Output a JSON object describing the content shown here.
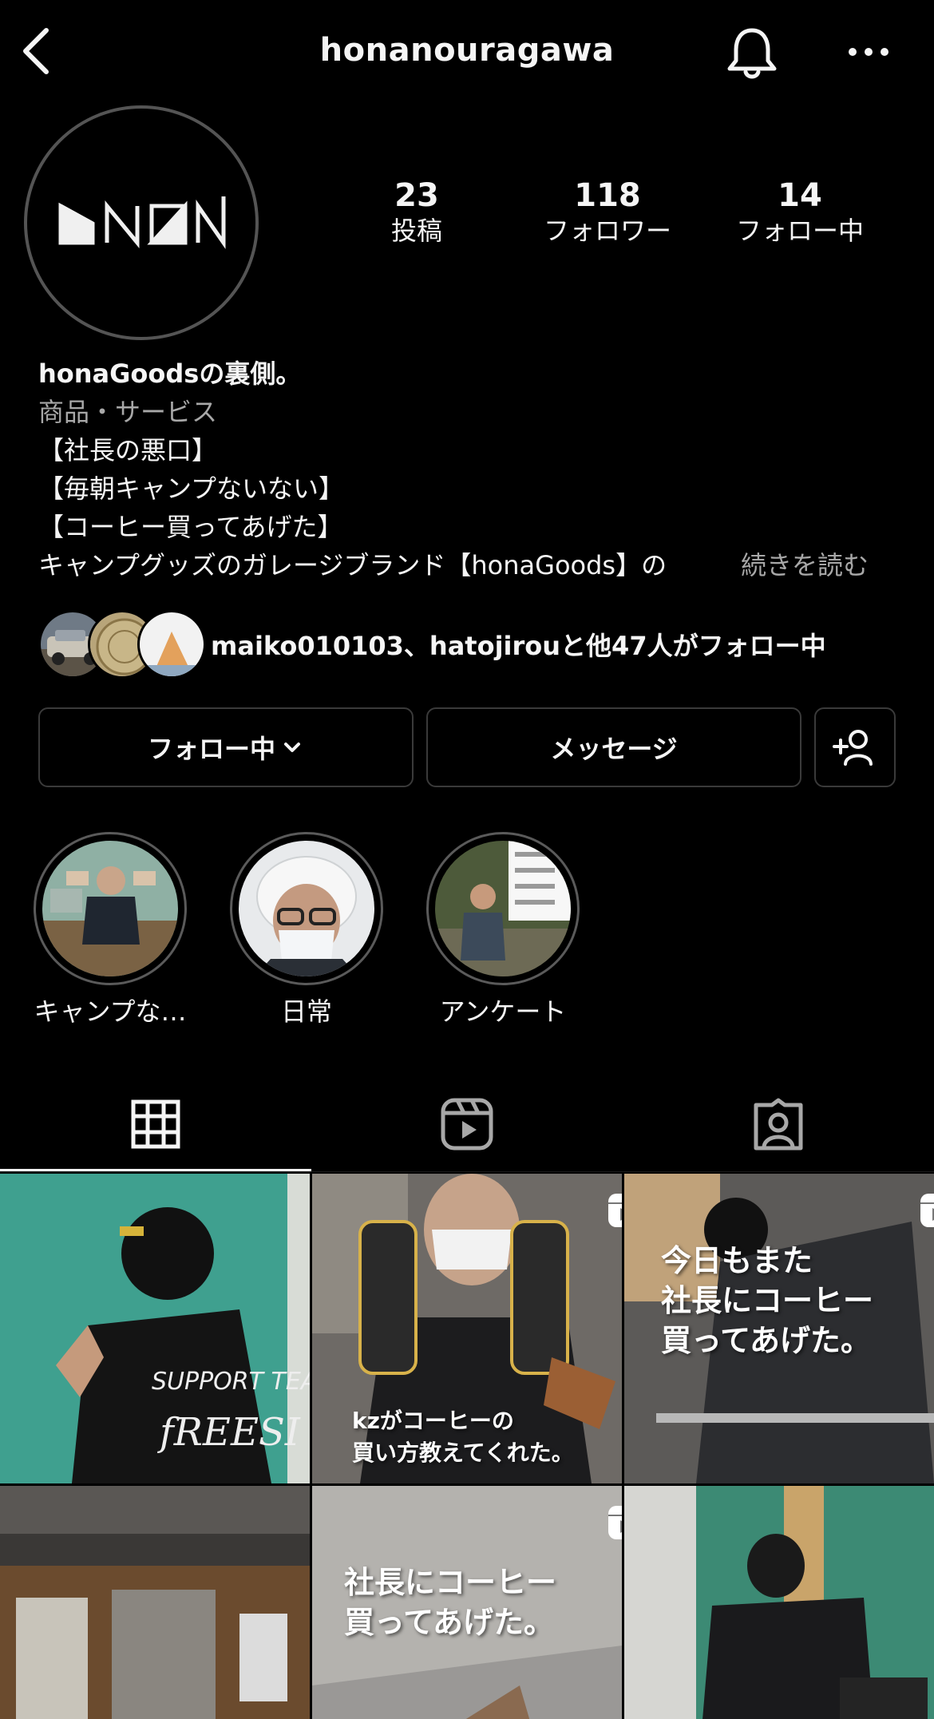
{
  "header": {
    "username": "honanouragawa"
  },
  "profile": {
    "logo_text": "ƅNON",
    "stats": [
      {
        "value": "23",
        "label": "投稿"
      },
      {
        "value": "118",
        "label": "フォロワー"
      },
      {
        "value": "14",
        "label": "フォロー中"
      }
    ]
  },
  "bio": {
    "name": "honaGoodsの裏側。",
    "category": "商品・サービス",
    "lines": [
      "【社長の悪口】",
      "【毎朝キャンプないない】",
      "【コーヒー買ってあげた】",
      "キャンプグッズのガレージブランド【honaGoods】の"
    ],
    "more": "続きを読む"
  },
  "followed_by": {
    "text": "maiko010103、hatojirouと他47人がフォロー中"
  },
  "actions": {
    "following_label": "フォロー中",
    "message_label": "メッセージ"
  },
  "highlights": [
    {
      "label": "キャンプな…"
    },
    {
      "label": "日常"
    },
    {
      "label": "アンケート"
    }
  ],
  "tabs": [
    {
      "name": "grid",
      "icon": "grid-icon",
      "active": true
    },
    {
      "name": "reels",
      "icon": "reels-icon",
      "active": false
    },
    {
      "name": "tagged",
      "icon": "tagged-icon",
      "active": false
    }
  ],
  "posts": [
    {
      "type": "photo",
      "caption": ""
    },
    {
      "type": "reel",
      "caption": "kzがコーヒーの\n買い方教えてくれた。"
    },
    {
      "type": "reel",
      "caption": "今日もまた\n社長にコーヒー\n買ってあげた。"
    },
    {
      "type": "photo",
      "caption": ""
    },
    {
      "type": "reel",
      "caption": "社長にコーヒー\n買ってあげた。"
    },
    {
      "type": "photo",
      "caption": ""
    }
  ]
}
